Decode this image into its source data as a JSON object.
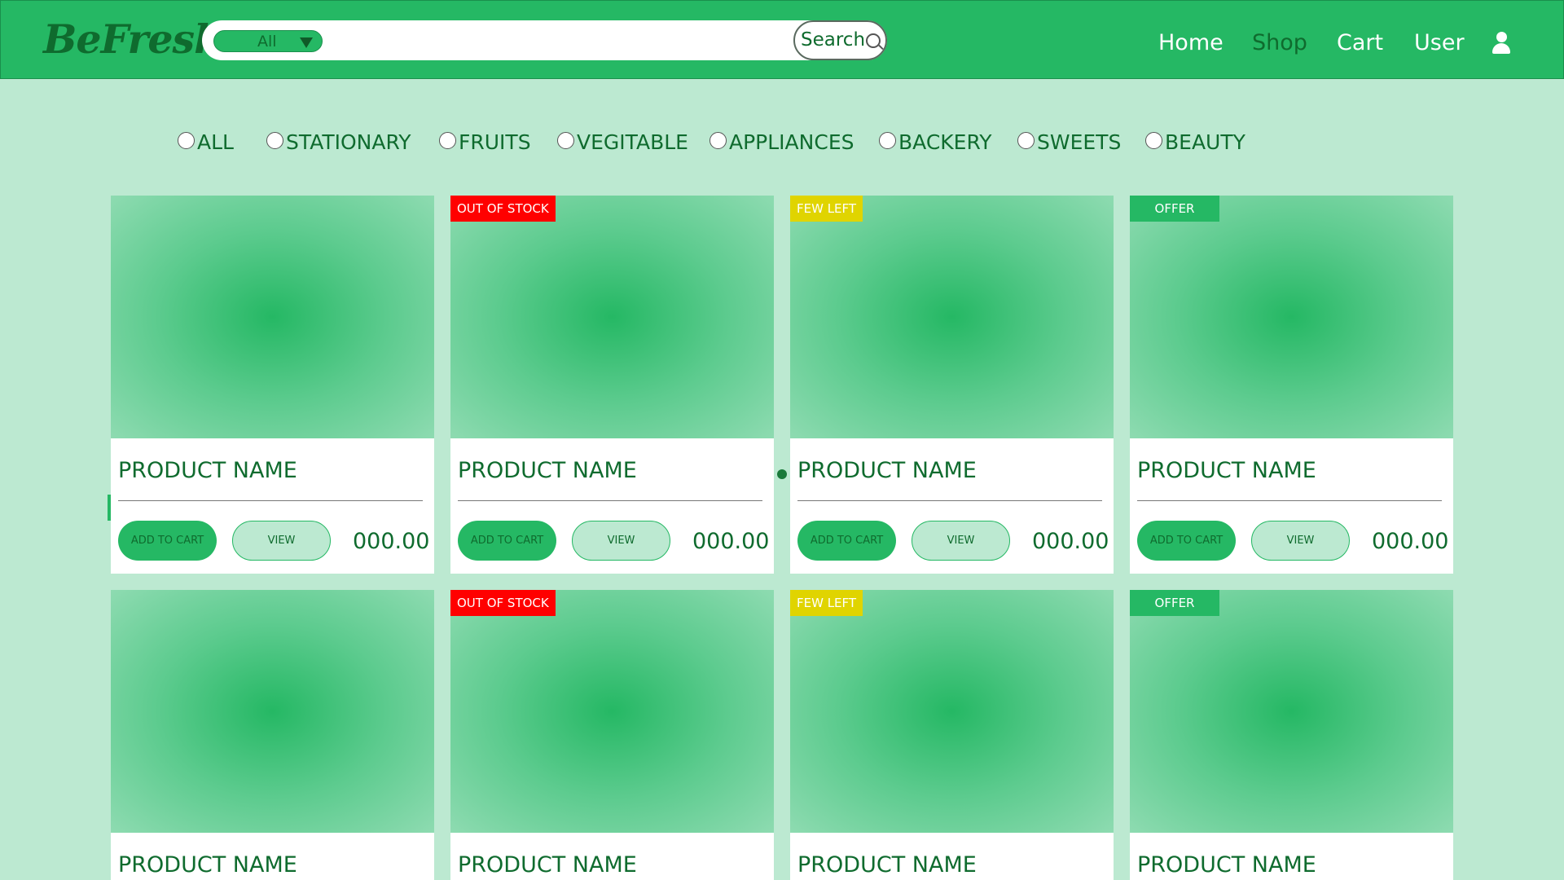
{
  "header": {
    "logo": "BeFresh",
    "search": {
      "category_selected": "All",
      "placeholder": "",
      "button_label": "Search"
    },
    "nav": {
      "home": "Home",
      "shop": "Shop",
      "cart": "Cart",
      "user": "User"
    }
  },
  "filters": [
    "ALL",
    "STATIONARY",
    "FRUITS",
    "VEGITABLE",
    "APPLIANCES",
    "BACKERY",
    "SWEETS",
    "BEAUTY"
  ],
  "products": [
    {
      "name": "PRODUCT NAME",
      "price": "000.00",
      "add_label": "ADD TO CART",
      "view_label": "VIEW",
      "badge": ""
    },
    {
      "name": "PRODUCT NAME",
      "price": "000.00",
      "add_label": "ADD TO CART",
      "view_label": "VIEW",
      "badge": "OUT OF STOCK"
    },
    {
      "name": "PRODUCT NAME",
      "price": "000.00",
      "add_label": "ADD TO CART",
      "view_label": "VIEW",
      "badge": "FEW LEFT"
    },
    {
      "name": "PRODUCT NAME",
      "price": "000.00",
      "add_label": "ADD TO CART",
      "view_label": "VIEW",
      "badge": "OFFER"
    },
    {
      "name": "PRODUCT NAME",
      "badge": ""
    },
    {
      "name": "PRODUCT NAME",
      "badge": "OUT OF STOCK"
    },
    {
      "name": "PRODUCT NAME",
      "badge": "FEW LEFT"
    },
    {
      "name": "PRODUCT NAME",
      "badge": "OFFER"
    }
  ],
  "colors": {
    "primary": "#25b864",
    "background": "#bce9d1",
    "text_dark_green": "#0f6b2e",
    "badge_out_of_stock": "#ff0000",
    "badge_few_left": "#e0d400",
    "badge_offer": "#25b864"
  }
}
